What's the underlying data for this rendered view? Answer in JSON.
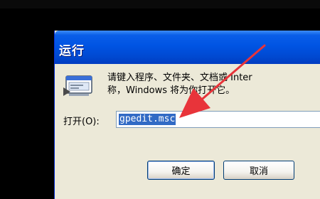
{
  "window": {
    "title": "运行"
  },
  "description": {
    "line1": "请键入程序、文件夹、文档或 Inter",
    "line2": "称，Windows 将为你打开它。"
  },
  "open_field": {
    "label": "打开(O):",
    "value": "gpedit.msc"
  },
  "buttons": {
    "ok": "确定",
    "cancel": "取消"
  },
  "icons": {
    "run_program": "run-program-icon",
    "annotation_arrow": "red-arrow-annotation"
  },
  "colors": {
    "titlebar": "#0054e3",
    "dialog_body": "#ece9d8",
    "selection": "#316ac5",
    "arrow": "#e8343a"
  }
}
